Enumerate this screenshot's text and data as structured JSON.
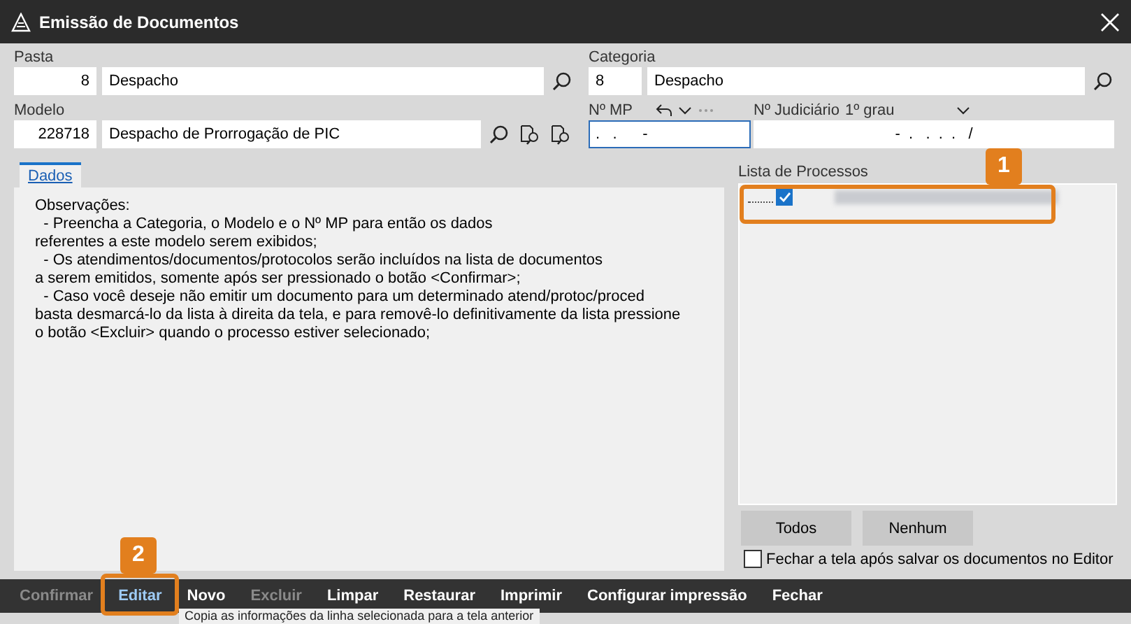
{
  "window": {
    "title": "Emissão de Documentos"
  },
  "pasta": {
    "label": "Pasta",
    "code": "8",
    "name": "Despacho"
  },
  "categoria": {
    "label": "Categoria",
    "code": "8",
    "name": "Despacho"
  },
  "modelo": {
    "label": "Modelo",
    "code": "228718",
    "name": "Despacho de Prorrogação de PIC"
  },
  "numero_mp": {
    "label": "Nº MP",
    "value": ".   .      -",
    "focused": true
  },
  "numero_judiciario": {
    "label": "Nº Judiciário",
    "instance": "1º grau",
    "value": "-  .   .  .  .   /"
  },
  "tabs": [
    {
      "label": "Dados",
      "selected": true
    }
  ],
  "observacoes": [
    "Observações:",
    "  - Preencha a Categoria, o Modelo e o Nº MP para então os dados",
    "referentes a este modelo serem exibidos;",
    "  - Os atendimentos/documentos/protocolos serão incluídos na lista de documentos",
    "a serem emitidos, somente após ser pressionado o botão <Confirmar>;",
    "  - Caso você deseje não emitir um documento para um determinado atend/protoc/proced",
    "basta desmarcá-lo da lista à direita da tela, e para removê-lo definitivamente da lista pressione",
    "o botão <Excluir> quando o processo estiver selecionado;"
  ],
  "lista_processos": {
    "label": "Lista de Processos",
    "items": [
      {
        "checked": true
      }
    ]
  },
  "list_buttons": [
    "Todos",
    "Nenhum"
  ],
  "close_option": {
    "label": "Fechar a tela após salvar os documentos no Editor",
    "checked": false
  },
  "toolbar": [
    {
      "label": "Confirmar",
      "disabled": true,
      "highlighted": false
    },
    {
      "label": "Editar",
      "disabled": false,
      "highlighted": true
    },
    {
      "label": "Novo",
      "disabled": false,
      "highlighted": false
    },
    {
      "label": "Excluir",
      "disabled": true,
      "highlighted": false
    },
    {
      "label": "Limpar",
      "disabled": false,
      "highlighted": false
    },
    {
      "label": "Restaurar",
      "disabled": false,
      "highlighted": false
    },
    {
      "label": "Imprimir",
      "disabled": false,
      "highlighted": false
    },
    {
      "label": "Configurar impressão",
      "disabled": false,
      "highlighted": false
    },
    {
      "label": "Fechar",
      "disabled": false,
      "highlighted": false
    }
  ],
  "tooltip": "Copia as informações da linha selecionada para a tela anterior",
  "callouts": [
    "1",
    "2"
  ]
}
